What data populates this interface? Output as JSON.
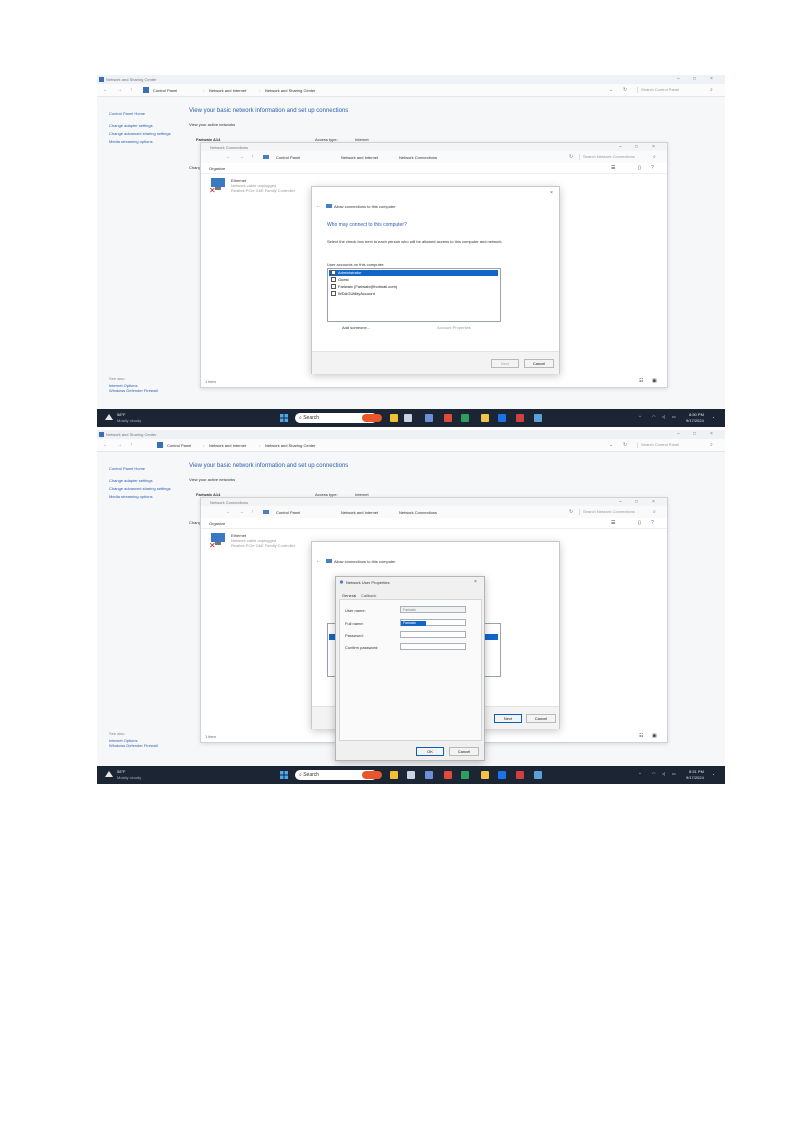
{
  "shot1": {
    "window_title": "Network and Sharing Center",
    "breadcrumb": [
      "Control Panel",
      "Network and Internet",
      "Network and Sharing Center"
    ],
    "search_placeholder": "Search Control Panel",
    "sidebar": {
      "home": "Control Panel Home",
      "links": [
        "Change adapter settings",
        "Change advanced sharing settings",
        "Media streaming options"
      ],
      "see_also_title": "See also",
      "see_also": [
        "Internet Options",
        "Windows Defender Firewall"
      ]
    },
    "main": {
      "heading": "View your basic network information and set up connections",
      "subheading": "View your active networks",
      "network_name": "Fariwalx A14",
      "access_type_label": "Access type:",
      "access_type_value": "Internet",
      "change_label": "Change"
    },
    "connections_window": {
      "title": "Network Connections",
      "breadcrumb": [
        "Control Panel",
        "Network and Internet",
        "Network Connections"
      ],
      "search_placeholder": "Search Network Connections",
      "organize": "Organize",
      "adapter_name": "Ethernet",
      "adapter_status": "Network cable unplugged",
      "adapter_device": "Realtek PCIe GbE Family Controller",
      "status_bar": "1 item"
    },
    "dialog": {
      "title": "Allow connections to this computer",
      "heading": "Who may connect to this computer?",
      "description": "Select the check box next to each person who will be allowed access to this computer and network.",
      "list_title": "User accounts on this computer:",
      "users": [
        {
          "name": "Administrator",
          "selected": true
        },
        {
          "name": "Guest",
          "selected": false
        },
        {
          "name": "Fariwalx (Fariwalx@hotmail.com)",
          "selected": false
        },
        {
          "name": "WDAGUtilityAccount",
          "selected": false
        }
      ],
      "add_someone": "Add someone...",
      "account_properties": "Account Properties",
      "next_button": "Next",
      "cancel_button": "Cancel"
    },
    "taskbar": {
      "weather_temp": "58°F",
      "weather_desc": "Mostly cloudy",
      "search": "Search",
      "time": "8:50 PM",
      "date": "9/17/2024"
    }
  },
  "shot2": {
    "window_title": "Network and Sharing Center",
    "breadcrumb": [
      "Control Panel",
      "Network and Internet",
      "Network and Sharing Center"
    ],
    "search_placeholder": "Search Control Panel",
    "sidebar": {
      "home": "Control Panel Home",
      "links": [
        "Change adapter settings",
        "Change advanced sharing settings",
        "Media streaming options"
      ],
      "see_also_title": "See also",
      "see_also": [
        "Internet Options",
        "Windows Defender Firewall"
      ]
    },
    "main": {
      "heading": "View your basic network information and set up connections",
      "subheading": "View your active networks",
      "network_name": "Fariwalx A14",
      "access_type_label": "Access type:",
      "access_type_value": "Internet",
      "change_label": "Change"
    },
    "connections_window": {
      "title": "Network Connections",
      "breadcrumb": [
        "Control Panel",
        "Network and Internet",
        "Network Connections"
      ],
      "search_placeholder": "Search Network Connections",
      "organize": "Organize",
      "adapter_name": "Ethernet",
      "adapter_status": "Network cable unplugged",
      "adapter_device": "Realtek PCIe GbE Family Controller",
      "status_bar": "1 item"
    },
    "dialog": {
      "title": "Allow connections to this computer",
      "next_button": "Next",
      "cancel_button": "Cancel"
    },
    "props": {
      "title": "Network User Properties",
      "tab_general": "General",
      "tab_callback": "Callback",
      "user_name_label": "User name:",
      "user_name_value": "Fariwalx",
      "full_name_label": "Full name:",
      "full_name_value": "Fariwalx",
      "password_label": "Password:",
      "confirm_label": "Confirm password:",
      "ok_button": "OK",
      "cancel_button": "Cancel"
    },
    "taskbar": {
      "weather_temp": "58°F",
      "weather_desc": "Mostly cloudy",
      "search": "Search",
      "time": "8:51 PM",
      "date": "9/17/2024"
    }
  }
}
